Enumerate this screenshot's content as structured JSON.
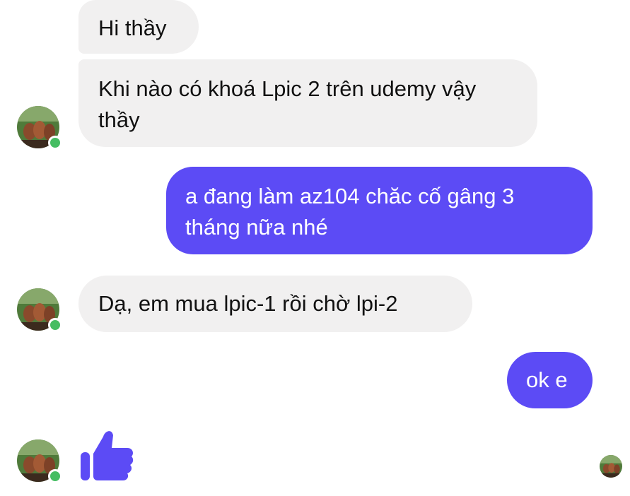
{
  "messages": [
    {
      "sender": "contact",
      "text": "Hi thầy"
    },
    {
      "sender": "contact",
      "text": "Khi nào có khoá Lpic 2 trên udemy vậy thầy"
    },
    {
      "sender": "me",
      "text": "a đang làm az104 chăc cố gâng 3 tháng nữa nhé"
    },
    {
      "sender": "contact",
      "text": "Dạ, em mua lpic-1 rồi chờ lpi-2"
    },
    {
      "sender": "me",
      "text": "ok e"
    },
    {
      "sender": "contact",
      "type": "like",
      "icon": "thumbs-up-icon"
    }
  ],
  "colors": {
    "outgoing_bubble": "#5c4bf5",
    "incoming_bubble": "#f1f0f0",
    "like_icon": "#5c4bf5",
    "online_status": "#45bd62"
  },
  "avatar": {
    "icon": "contact-avatar",
    "online": true
  },
  "seen_indicator": {
    "icon": "seen-avatar"
  }
}
